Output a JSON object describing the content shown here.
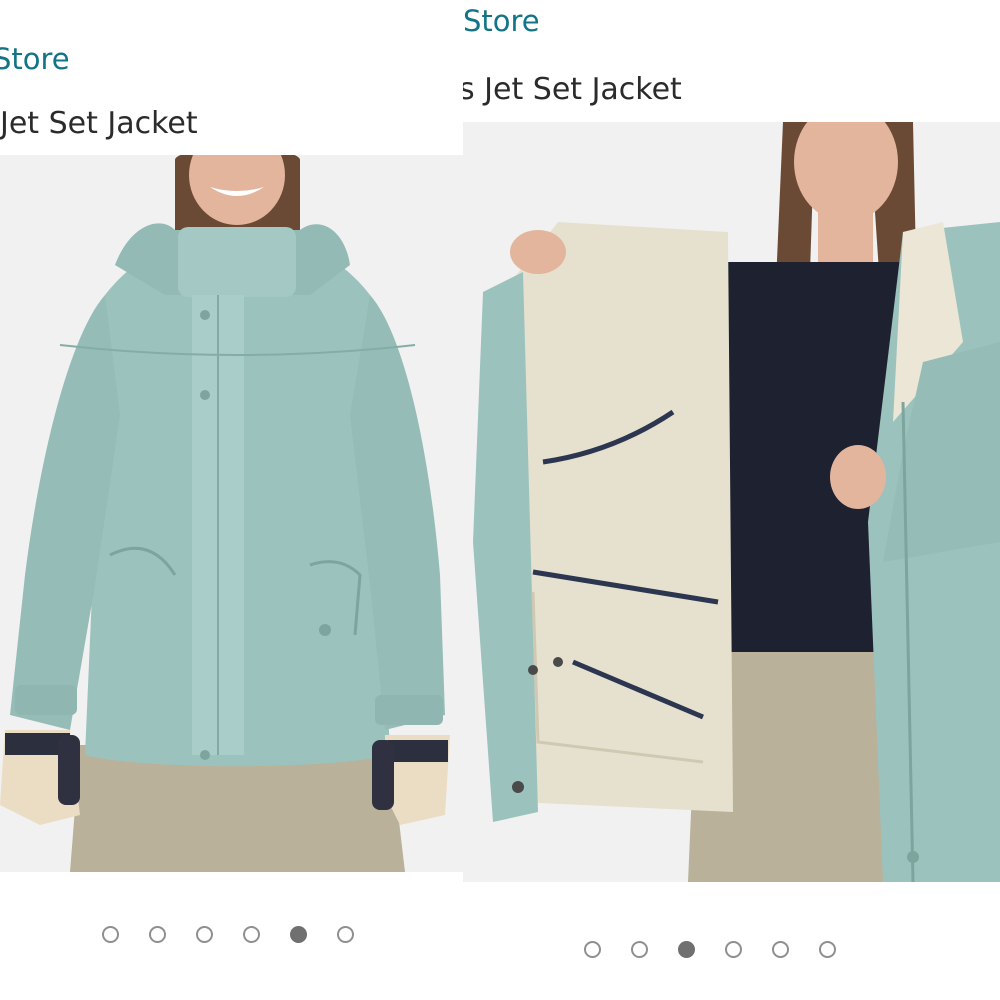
{
  "carousels": [
    {
      "store_link": "Store",
      "title": "Jet Set Jacket",
      "image_alt": "Woman wearing a light teal hooded ski jacket with the zipper closed",
      "dots": [
        false,
        false,
        false,
        false,
        true,
        false
      ]
    },
    {
      "store_link": "Store",
      "title": "s Jet Set Jacket",
      "image_alt": "Woman holding open a light teal ski jacket showing the cream interior lining",
      "dots": [
        false,
        false,
        true,
        false,
        false,
        false
      ]
    }
  ],
  "colors": {
    "link": "#127486",
    "title_text": "#2b2b2b",
    "jacket": "#9cc2bd",
    "lining": "#e6e1cf",
    "pants": "#b9b199",
    "tshirt": "#1e2230",
    "dot_active": "#707070",
    "dot_inactive_border": "#8f8f8f"
  }
}
